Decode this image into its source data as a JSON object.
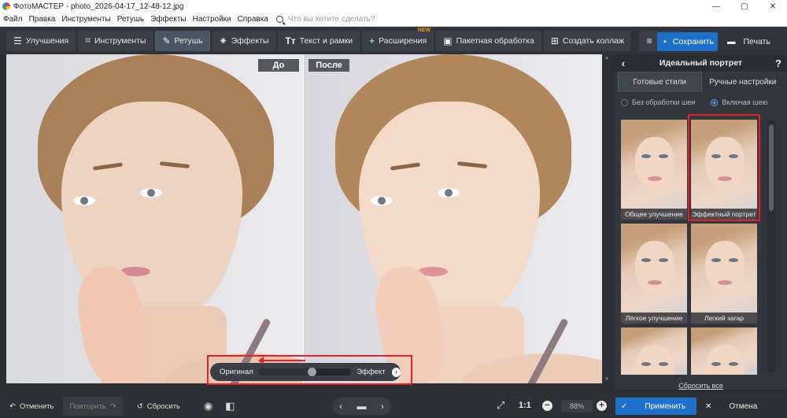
{
  "window": {
    "title": "ФотоМАСТЕР - photo_2026-04-17_12-48-12.jpg",
    "min": "—",
    "max": "▢",
    "close": "✕"
  },
  "menu": {
    "items": [
      "Файл",
      "Правка",
      "Инструменты",
      "Ретушь",
      "Эффекты",
      "Настройки",
      "Справка"
    ],
    "search_placeholder": "Что вы хотите сделать?"
  },
  "toolbar": {
    "improve": "Улучшения",
    "tools": "Инструменты",
    "retouch": "Ретушь",
    "effects": "Эффекты",
    "text_frames": "Текст и рамки",
    "extensions": "Расширения",
    "new_badge": "NEW",
    "batch": "Пакетная обработка",
    "collage": "Создать коллаж",
    "save": "Сохранить",
    "print": "Печать"
  },
  "canvas": {
    "before_label": "До",
    "after_label": "После"
  },
  "compare": {
    "left": "Оригинал",
    "right": "Эффект",
    "position": 0.58
  },
  "panel": {
    "title": "Идеальный портрет",
    "tabs": [
      "Готовые стили",
      "Ручные настройки"
    ],
    "radio_without": "Без обработки шеи",
    "radio_with": "Включая шею",
    "styles": [
      "Общее улучшение",
      "Эффектный портрет",
      "Лёгкое улучшение",
      "Легкий загар",
      "",
      ""
    ],
    "selected_style": "Эффектный портрет",
    "reset_all": "Сбросить все"
  },
  "bottom": {
    "undo": "Отменить",
    "redo": "Повторить",
    "reset": "Сбросить",
    "zoom_1to1": "1:1",
    "zoom": "88%",
    "apply": "Применить",
    "cancel": "Отмена"
  },
  "colors": {
    "accent": "#1e6fc9",
    "highlight": "#e0202a",
    "new_badge": "#f39c12"
  }
}
